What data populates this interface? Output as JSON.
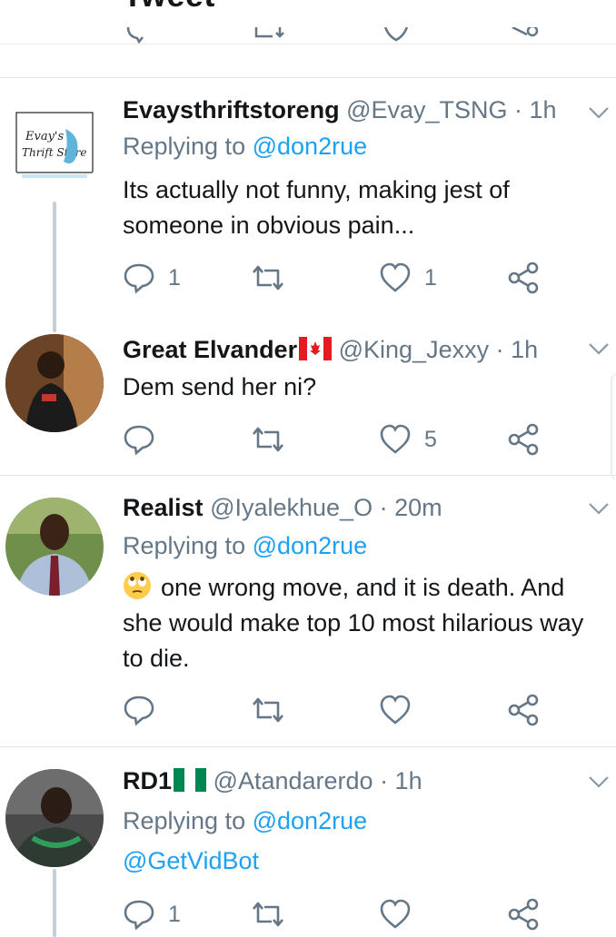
{
  "header": {
    "title": "Tweet"
  },
  "tweets": [
    {
      "name": "Evaysthriftstoreng",
      "handle": "@Evay_TSNG",
      "time": "· 1h",
      "replying_label": "Replying to",
      "replying_handle": "@don2rue",
      "text": "Its actually not funny, making jest of someone in obvious pain...",
      "reply_count": "1",
      "like_count": "1",
      "avatar_logo_text": "Evay's Thrift Store"
    },
    {
      "name": "Great Elvander",
      "flag": "canada-flag-icon",
      "handle": "@King_Jexxy",
      "time": "· 1h",
      "text": "Dem send her ni?",
      "reply_count": "",
      "like_count": "5"
    },
    {
      "name": "Realist",
      "handle": "@Iyalekhue_O",
      "time": "· 20m",
      "replying_label": "Replying to",
      "replying_handle": "@don2rue",
      "emoji": "face-with-rolling-eyes-icon",
      "text": "one wrong move, and it is death. And she would make top 10 most hilarious way to die.",
      "reply_count": "",
      "like_count": ""
    },
    {
      "name": "RD1",
      "flag": "nigeria-flag-icon",
      "handle": "@Atandarerdo",
      "time": "· 1h",
      "replying_label": "Replying to",
      "replying_handle": "@don2rue",
      "text": "@GetVidBot",
      "reply_count": "1",
      "like_count": ""
    }
  ],
  "colors": {
    "accent": "#1da1f2",
    "secondary_text": "#657786",
    "divider": "#e1e8ed"
  }
}
